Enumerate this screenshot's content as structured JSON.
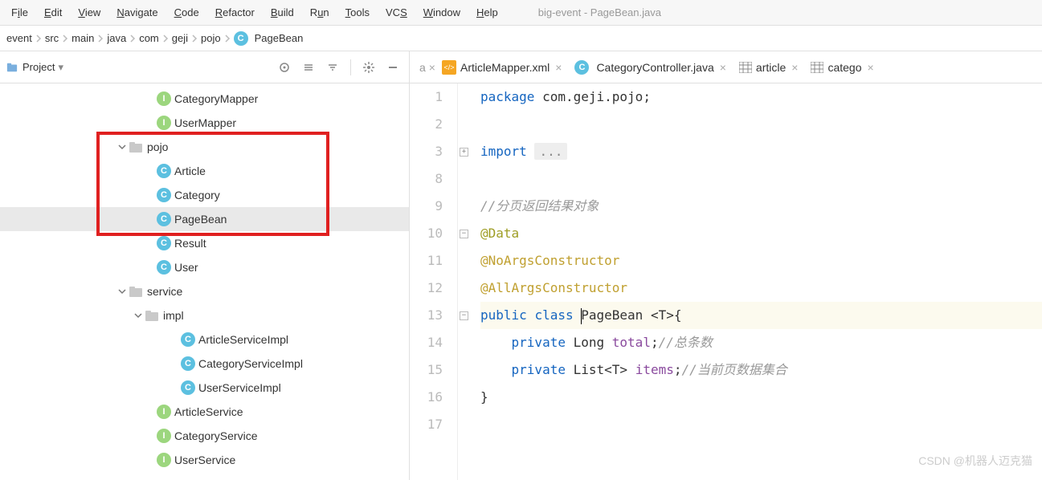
{
  "menu": {
    "items": [
      {
        "label": "File",
        "u": 1
      },
      {
        "label": "Edit",
        "u": 0
      },
      {
        "label": "View",
        "u": 0
      },
      {
        "label": "Navigate",
        "u": 0
      },
      {
        "label": "Code",
        "u": 0
      },
      {
        "label": "Refactor",
        "u": 0
      },
      {
        "label": "Build",
        "u": 0
      },
      {
        "label": "Run",
        "u": 1
      },
      {
        "label": "Tools",
        "u": 0
      },
      {
        "label": "VCS",
        "u": 2
      },
      {
        "label": "Window",
        "u": 0
      },
      {
        "label": "Help",
        "u": 0
      }
    ],
    "window_title": "big-event - PageBean.java"
  },
  "breadcrumb": {
    "parts": [
      "event",
      "src",
      "main",
      "java",
      "com",
      "geji",
      "pojo"
    ],
    "file": "PageBean"
  },
  "sidebar": {
    "title": "Project",
    "tree": [
      {
        "type": "interface",
        "label": "CategoryMapper",
        "indent": "indent-2"
      },
      {
        "type": "interface",
        "label": "UserMapper",
        "indent": "indent-2"
      },
      {
        "type": "folder-open",
        "label": "pojo",
        "indent": "indent-1"
      },
      {
        "type": "class",
        "label": "Article",
        "indent": "indent-2"
      },
      {
        "type": "class",
        "label": "Category",
        "indent": "indent-2"
      },
      {
        "type": "class",
        "label": "PageBean",
        "indent": "indent-2",
        "selected": true
      },
      {
        "type": "class",
        "label": "Result",
        "indent": "indent-2"
      },
      {
        "type": "class",
        "label": "User",
        "indent": "indent-2"
      },
      {
        "type": "folder-open",
        "label": "service",
        "indent": "indent-1"
      },
      {
        "type": "folder-open",
        "label": "impl",
        "indent": "indent-1b"
      },
      {
        "type": "class",
        "label": "ArticleServiceImpl",
        "indent": "indent-3"
      },
      {
        "type": "class",
        "label": "CategoryServiceImpl",
        "indent": "indent-3"
      },
      {
        "type": "class",
        "label": "UserServiceImpl",
        "indent": "indent-3"
      },
      {
        "type": "interface",
        "label": "ArticleService",
        "indent": "indent-2"
      },
      {
        "type": "interface",
        "label": "CategoryService",
        "indent": "indent-2"
      },
      {
        "type": "interface",
        "label": "UserService",
        "indent": "indent-2"
      }
    ]
  },
  "tabs": [
    {
      "icon": "xml",
      "label": "ArticleMapper.xml"
    },
    {
      "icon": "class",
      "label": "CategoryController.java"
    },
    {
      "icon": "table",
      "label": "article"
    },
    {
      "icon": "table",
      "label": "catego"
    }
  ],
  "code": {
    "line_numbers": [
      "1",
      "2",
      "3",
      "8",
      "9",
      "10",
      "11",
      "12",
      "13",
      "14",
      "15",
      "16",
      "17"
    ],
    "tokens": {
      "package": "package",
      "pkg_name": "com.geji.pojo",
      "import": "import",
      "import_fold": "...",
      "cmt_top": "//分页返回结果对象",
      "anno_data": "@Data",
      "anno_noargs": "@NoArgsConstructor",
      "anno_allargs": "@AllArgsConstructor",
      "public": "public",
      "class": "class",
      "class_name": "PageBean",
      "generic": "<T>",
      "lbrace": "{",
      "private": "private",
      "Long": "Long",
      "total": "total",
      "cmt_total": "//总条数",
      "List": "List",
      "T": "<T>",
      "items": "items",
      "cmt_items": "//当前页数据集合",
      "rbrace": "}"
    }
  },
  "watermark": "CSDN @机器人迈克猫"
}
